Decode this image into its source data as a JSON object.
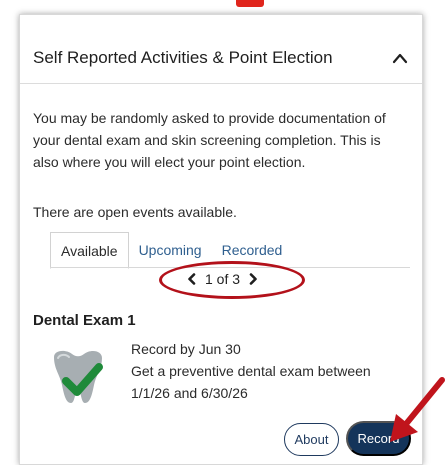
{
  "card": {
    "title": "Self Reported Activities & Point Election",
    "description": "You may be randomly asked to provide documentation of your dental exam and skin screening completion. This is also where you will elect your point election.",
    "open_events": "There are open events available."
  },
  "tabs": [
    {
      "label": "Available",
      "active": true
    },
    {
      "label": "Upcoming",
      "active": false
    },
    {
      "label": "Recorded",
      "active": false
    }
  ],
  "pager": {
    "text": "1 of 3"
  },
  "activity": {
    "title": "Dental Exam 1",
    "record_by": "Record by Jun 30",
    "description": "Get a preventive dental exam between 1/1/26 and 6/30/26",
    "icon": "tooth-check-icon"
  },
  "buttons": {
    "about": "About",
    "record": "Record"
  },
  "colors": {
    "link": "#2f5f8f",
    "primary": "#14345a",
    "annotation_red": "#c0141c",
    "check_green": "#1f8a3a",
    "tooth_gray": "#9aa3a8"
  },
  "icons": {
    "collapse": "chevron-up-icon",
    "prev": "chevron-left-icon",
    "next": "chevron-right-icon"
  }
}
